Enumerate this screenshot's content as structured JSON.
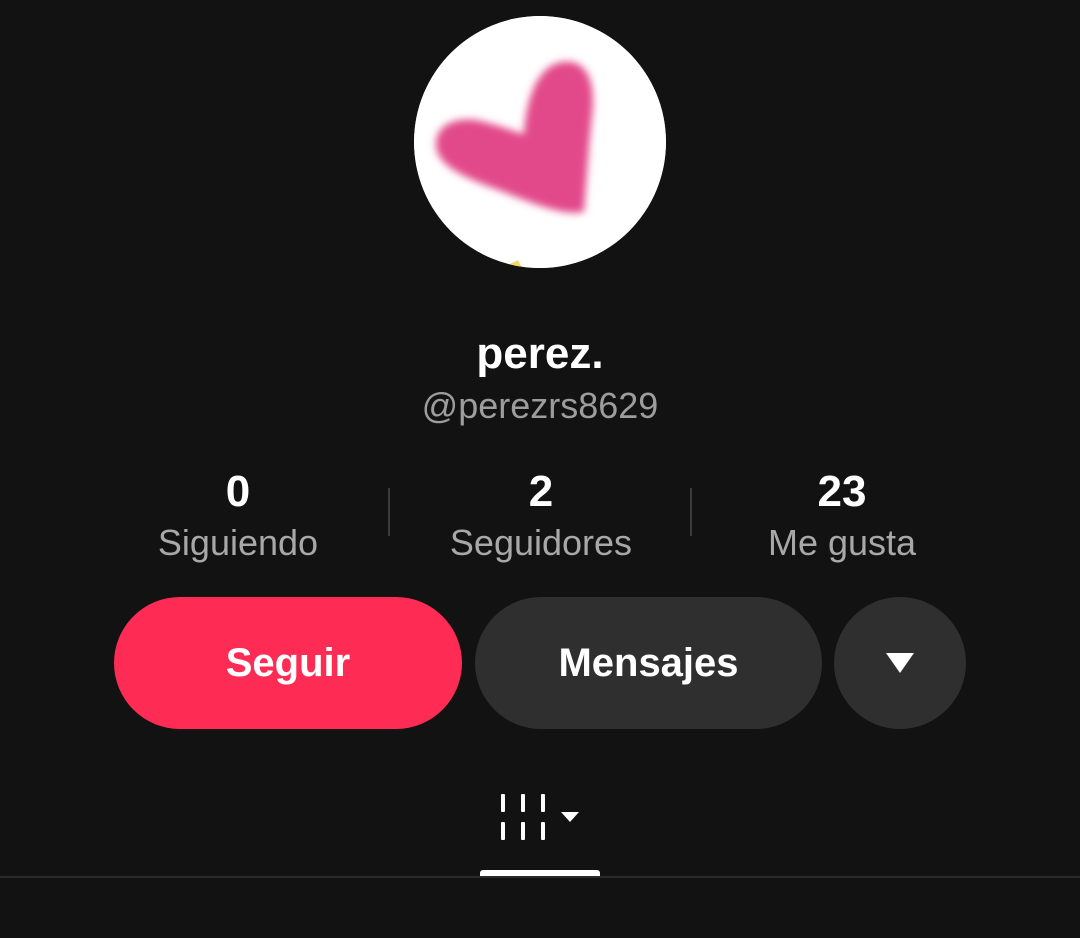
{
  "profile": {
    "display_name": "perez.",
    "username": "@perezrs8629",
    "avatar_icon": "pink-heart-avatar"
  },
  "stats": {
    "following": {
      "value": "0",
      "label": "Siguiendo"
    },
    "followers": {
      "value": "2",
      "label": "Seguidores"
    },
    "likes": {
      "value": "23",
      "label": "Me gusta"
    }
  },
  "actions": {
    "follow_label": "Seguir",
    "message_label": "Mensajes",
    "more_icon": "triangle-down-icon"
  },
  "tabs": {
    "active_icon": "video-grid-icon",
    "dropdown_icon": "caret-down-icon"
  },
  "colors": {
    "background": "#121212",
    "follow_button": "#fe2c55",
    "secondary_button": "#2f2f2f",
    "heart": "#e2488a",
    "muted_text": "#a8a8a8"
  }
}
